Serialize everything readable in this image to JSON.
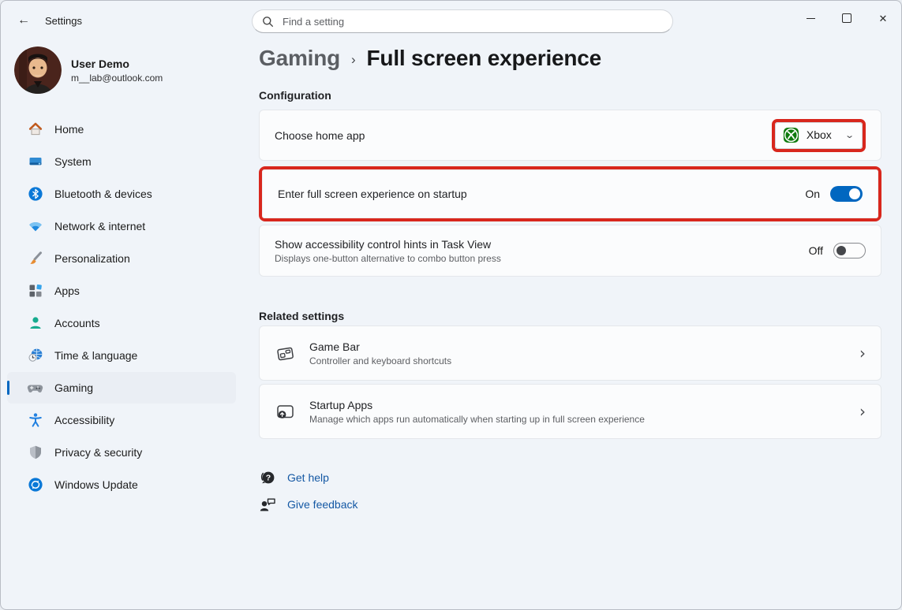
{
  "window": {
    "title": "Settings"
  },
  "titlebar": {
    "search_placeholder": "Find a setting"
  },
  "profile": {
    "name": "User Demo",
    "email": "m__lab@outlook.com"
  },
  "sidebar": {
    "items": [
      {
        "label": "Home",
        "icon": "home-icon",
        "selected": false
      },
      {
        "label": "System",
        "icon": "system-icon",
        "selected": false
      },
      {
        "label": "Bluetooth & devices",
        "icon": "bluetooth-icon",
        "selected": false
      },
      {
        "label": "Network & internet",
        "icon": "network-icon",
        "selected": false
      },
      {
        "label": "Personalization",
        "icon": "personalization-icon",
        "selected": false
      },
      {
        "label": "Apps",
        "icon": "apps-icon",
        "selected": false
      },
      {
        "label": "Accounts",
        "icon": "accounts-icon",
        "selected": false
      },
      {
        "label": "Time & language",
        "icon": "time-language-icon",
        "selected": false
      },
      {
        "label": "Gaming",
        "icon": "gaming-icon",
        "selected": true
      },
      {
        "label": "Accessibility",
        "icon": "accessibility-icon",
        "selected": false
      },
      {
        "label": "Privacy & security",
        "icon": "privacy-icon",
        "selected": false
      },
      {
        "label": "Windows Update",
        "icon": "windows-update-icon",
        "selected": false
      }
    ]
  },
  "breadcrumb": {
    "parent": "Gaming",
    "separator": "›",
    "current": "Full screen experience"
  },
  "configuration": {
    "title": "Configuration",
    "choose_home_app": {
      "label": "Choose home app",
      "value": "Xbox",
      "icon": "xbox-icon",
      "annotated": true
    },
    "fullscreen_startup": {
      "label": "Enter full screen experience on startup",
      "state_label": "On",
      "state": "on",
      "annotated": true
    },
    "accessibility_hints": {
      "label": "Show accessibility control hints in Task View",
      "description": "Displays one-button alternative to combo button press",
      "state_label": "Off",
      "state": "off"
    }
  },
  "related_settings": {
    "title": "Related settings",
    "items": [
      {
        "title": "Game Bar",
        "subtitle": "Controller and keyboard shortcuts",
        "icon": "game-bar-icon"
      },
      {
        "title": "Startup Apps",
        "subtitle": "Manage which apps run automatically when starting up in full screen experience",
        "icon": "startup-apps-icon"
      }
    ]
  },
  "footer_links": [
    {
      "label": "Get help",
      "icon": "get-help-icon"
    },
    {
      "label": "Give feedback",
      "icon": "give-feedback-icon"
    }
  ],
  "colors": {
    "accent": "#0067c0",
    "annotation_red": "#d8271d",
    "link": "#1458a4",
    "xbox_green": "#0e7a0d",
    "window_background": "#f0f4f9",
    "card_background": "#fbfcfd"
  }
}
